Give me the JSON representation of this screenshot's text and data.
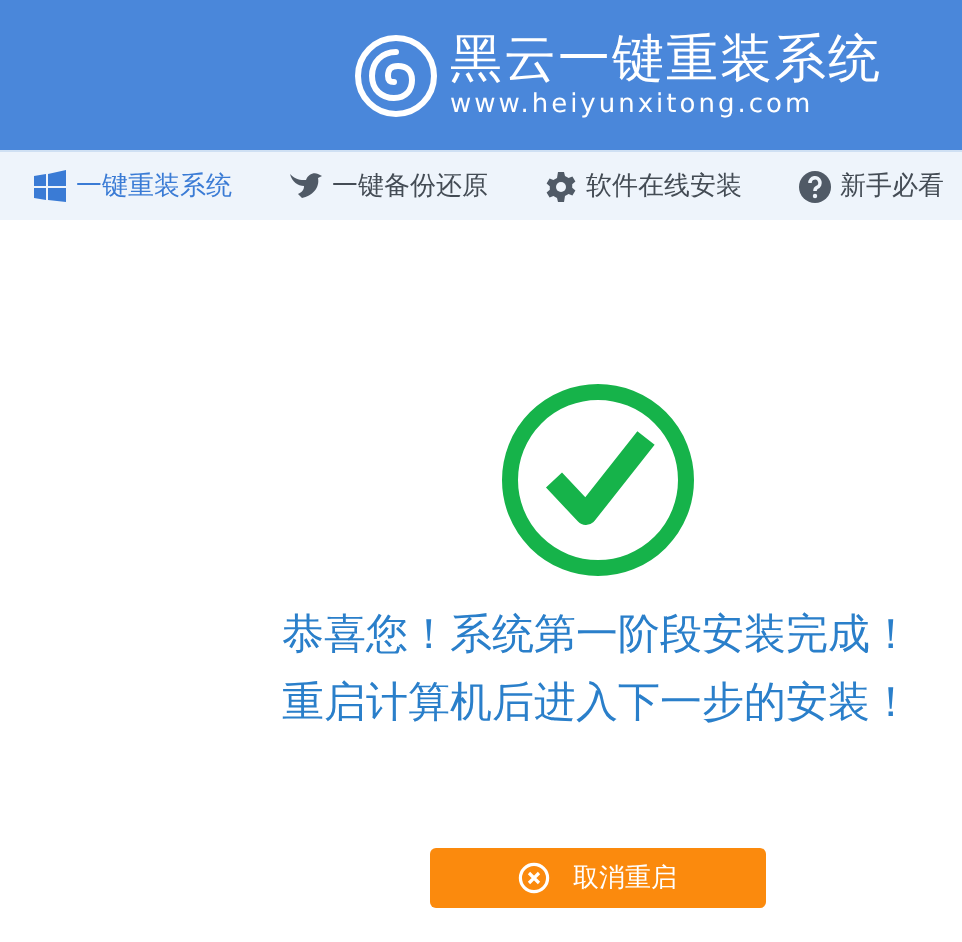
{
  "header": {
    "title": "黑云一键重装系统",
    "url": "www.heiyunxitong.com"
  },
  "tabs": [
    {
      "label": "一键重装系统",
      "selected": true
    },
    {
      "label": "一键备份还原",
      "selected": false
    },
    {
      "label": "软件在线安装",
      "selected": false
    },
    {
      "label": "新手必看",
      "selected": false
    }
  ],
  "message": [
    "恭喜您！系统第一阶段安装完成！",
    "重启计算机后进入下一步的安装！"
  ],
  "button": {
    "label": "取消重启"
  }
}
